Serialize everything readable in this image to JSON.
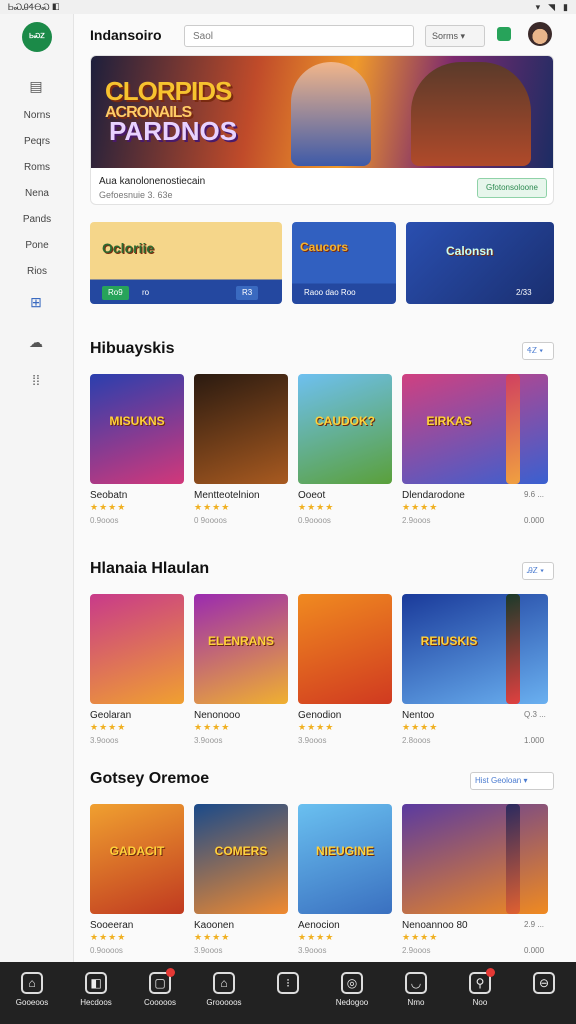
{
  "status": {
    "left": "ᏏᏍᎯᏎᎾᏍ ◧",
    "icons": [
      "▾",
      "◥",
      "▮"
    ]
  },
  "sidebar": {
    "logo_text": "ᏏᏍᏃ",
    "items": [
      "Norns",
      "Peqrs",
      "Roms",
      "Nena",
      "Pands",
      "Pone",
      "Rios"
    ]
  },
  "topbar": {
    "title": "Indansoiro",
    "search_placeholder": "Saol",
    "dropdown_label": "Sorms ▾"
  },
  "hero": {
    "title_line1": "CLORPIDS",
    "title_line2": "ACRONAILS",
    "title_line3": "PARDNOS",
    "subtitle": "Aua kanolonenostiecain",
    "meta": "Gefoesnuie 3. 63e",
    "button": "Gfotonsoloone"
  },
  "promos": [
    {
      "label": "Ocloriie",
      "chip_left": "Ro9",
      "chip_mid": "ro",
      "chip_right": "R3"
    },
    {
      "label": "Caucors",
      "chip_left": "Raoo dao Roo",
      "chip_mid": "",
      "chip_right": ""
    },
    {
      "label": "Calonsn",
      "chip_left": "",
      "chip_mid": "",
      "chip_right": "2/33"
    }
  ],
  "sections": [
    {
      "title": "Hibuayskis",
      "button": "ᏎᏃ ▾",
      "cards": [
        {
          "name": "Seobatn",
          "stars": "★★★★",
          "meta": "0.9ooos",
          "art": "MISUKNS",
          "right": ""
        },
        {
          "name": "Mentteotelnion",
          "stars": "★★★★",
          "meta": "0 9oooos",
          "art": "",
          "right": ""
        },
        {
          "name": "Ooeot",
          "stars": "★★★★",
          "meta": "0.9oooos",
          "art": "CAUDOK?",
          "right": ""
        },
        {
          "name": "Dlendarodone",
          "stars": "★★★★",
          "meta": "2.9ooos",
          "art": "EIRKAS",
          "right": "9.6 ..."
        },
        {
          "name": "",
          "stars": "",
          "meta": "",
          "art": "",
          "right": "0.000"
        }
      ]
    },
    {
      "title": "Hlanaia Hlaulan",
      "button": "ᎯᏃ ▾",
      "cards": [
        {
          "name": "Geolaran",
          "stars": "★★★★",
          "meta": "3.9ooos",
          "art": "",
          "right": ""
        },
        {
          "name": "Nenonooo",
          "stars": "★★★★",
          "meta": "3.9ooos",
          "art": "ELENRANS",
          "right": ""
        },
        {
          "name": "Genodion",
          "stars": "★★★★",
          "meta": "3.9ooos",
          "art": "",
          "right": ""
        },
        {
          "name": "Nentoo",
          "stars": "★★★★",
          "meta": "2.8ooos",
          "art": "REIUSKIS",
          "right": "Q.3 ..."
        },
        {
          "name": "",
          "stars": "",
          "meta": "",
          "art": "",
          "right": "1.000"
        }
      ]
    },
    {
      "title": "Gotsey Oremoe",
      "button": "Hist Geoloan ▾",
      "cards": [
        {
          "name": "Sooeeran",
          "stars": "★★★★",
          "meta": "0.9oooos",
          "art": "GADACIT",
          "right": ""
        },
        {
          "name": "Kaoonen",
          "stars": "★★★★",
          "meta": "3.9ooos",
          "art": "COMERS",
          "right": ""
        },
        {
          "name": "Aenocion",
          "stars": "★★★★",
          "meta": "3.9ooos",
          "art": "NIEUGINE",
          "right": ""
        },
        {
          "name": "Nenoannoo 80",
          "stars": "★★★★",
          "meta": "2.9ooos",
          "art": "",
          "right": "2.9 ..."
        },
        {
          "name": "",
          "stars": "",
          "meta": "",
          "art": "",
          "right": "0.000"
        }
      ]
    }
  ],
  "bottomnav": [
    {
      "label": "Gooeoos",
      "icon": "⌂"
    },
    {
      "label": "Hecdoos",
      "icon": "◧"
    },
    {
      "label": "Cooooos",
      "icon": "▢"
    },
    {
      "label": "Grooooos",
      "icon": "⌂"
    },
    {
      "label": "",
      "icon": "⁝"
    },
    {
      "label": "Nedogoo",
      "icon": "◎"
    },
    {
      "label": "Nmo",
      "icon": "◡"
    },
    {
      "label": "Noo",
      "icon": "⚲"
    },
    {
      "label": "",
      "icon": "⊖"
    }
  ],
  "colors": {
    "brand": "#1b8a48",
    "accent": "#27a35a",
    "promo_blue": "#2448a0",
    "star": "#f0b020",
    "badge": "#e53935"
  }
}
